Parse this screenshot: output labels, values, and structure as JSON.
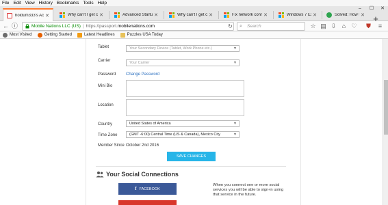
{
  "menu": [
    "File",
    "Edit",
    "View",
    "History",
    "Bookmarks",
    "Tools",
    "Help"
  ],
  "tabs": [
    {
      "title": "holdum333's Acc…",
      "icon": "mobile-nations-favicon",
      "active": true
    },
    {
      "title": "Why can't I get c…",
      "icon": "windows-favicon",
      "active": false
    },
    {
      "title": "Advanced Startu…",
      "icon": "windows-favicon",
      "active": false
    },
    {
      "title": "Why can't I get c…",
      "icon": "windows-favicon",
      "active": false
    },
    {
      "title": "Fix network conn…",
      "icon": "windows-favicon",
      "active": false
    },
    {
      "title": "Windows 7 Explo…",
      "icon": "windows-favicon",
      "active": false
    },
    {
      "title": "Solved: How to tr…",
      "icon": "solved-favicon",
      "active": false
    }
  ],
  "nav": {
    "ssl_owner": "Mobile Nations LLC (US)",
    "url_prefix": "https://passport.",
    "url_host": "mobilenations.com",
    "search_placeholder": "Search"
  },
  "bookmarks": [
    {
      "label": "Most Visited",
      "icon": "gear-icon",
      "color": "#6b6b6b"
    },
    {
      "label": "Getting Started",
      "icon": "firefox-icon",
      "color": "#e66000"
    },
    {
      "label": "Latest Headlines",
      "icon": "rss-icon",
      "color": "#f39c12"
    },
    {
      "label": "Puzzles USA Today",
      "icon": "folder-icon",
      "color": "#e8c25a"
    }
  ],
  "form": {
    "tablet_label": "Tablet",
    "tablet_value": "Your Secondary Device (Tablet, Work Phone etc.)",
    "carrier_label": "Carrier",
    "carrier_value": "Your Carrier",
    "password_label": "Password",
    "password_link": "Change Password",
    "minibio_label": "Mini Bio",
    "location_label": "Location",
    "country_label": "Country",
    "country_value": "United States of America",
    "timezone_label": "Time Zone",
    "timezone_value": "(GMT -6:00) Central Time (US & Canada), Mexico City",
    "member_label": "Member Since",
    "member_value": "October 2nd 2016",
    "save_label": "SAVE CHANGES"
  },
  "social": {
    "title": "Your Social Connections",
    "facebook_label": "FACEBOOK",
    "description": "When you connect one or more social services you will be able to sign-in using that service in the future."
  },
  "colors": {
    "accent_tab": "#ff7a2f",
    "save_button": "#27b5e8",
    "facebook": "#3b5998",
    "google": "#d9362b",
    "link": "#2a6fbf"
  }
}
